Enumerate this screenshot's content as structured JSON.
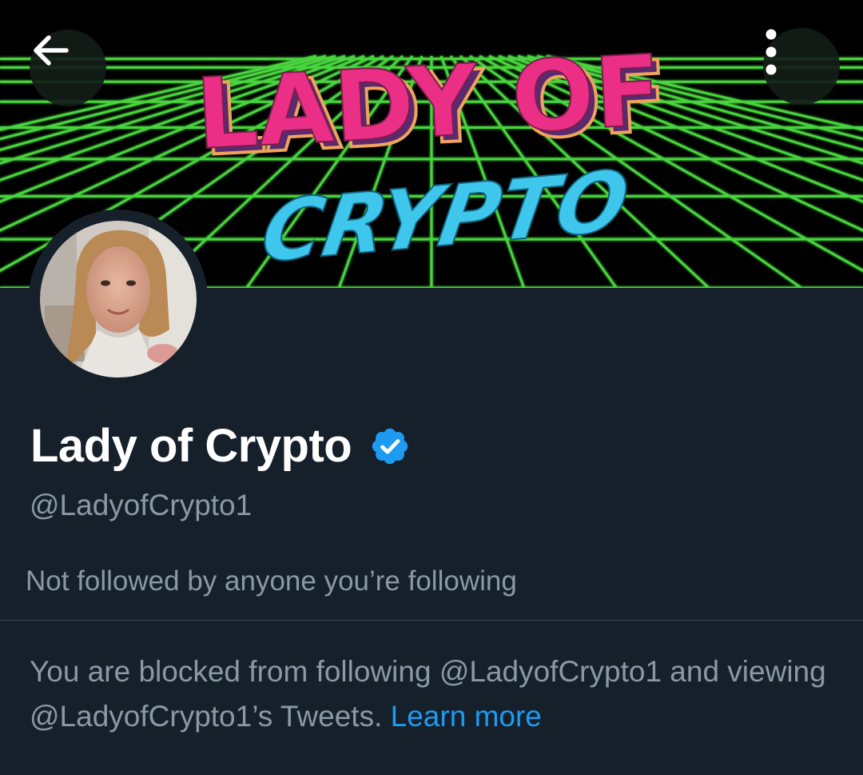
{
  "header": {
    "back_icon": "arrow-left-icon",
    "more_icon": "more-vertical-icon",
    "banner": {
      "line1": "LADY OF",
      "line2": "CRYPTO",
      "colors": {
        "title_pink": "#ec2f86",
        "title_cyan": "#3fc6ec",
        "grid_green": "#4de043"
      }
    }
  },
  "profile": {
    "display_name": "Lady of Crypto",
    "verified_icon": "verified-badge-icon",
    "handle": "@LadyofCrypto1",
    "followed_by": "Not followed by anyone you’re following"
  },
  "blocked_notice": {
    "message": "You are blocked from following @LadyofCrypto1 and viewing @LadyofCrypto1’s Tweets.",
    "link_label": "Learn more"
  },
  "colors": {
    "background": "#15202b",
    "text_primary": "#ffffff",
    "text_secondary": "#8b98a5",
    "accent": "#1d9bf0",
    "divider": "#38444d"
  }
}
